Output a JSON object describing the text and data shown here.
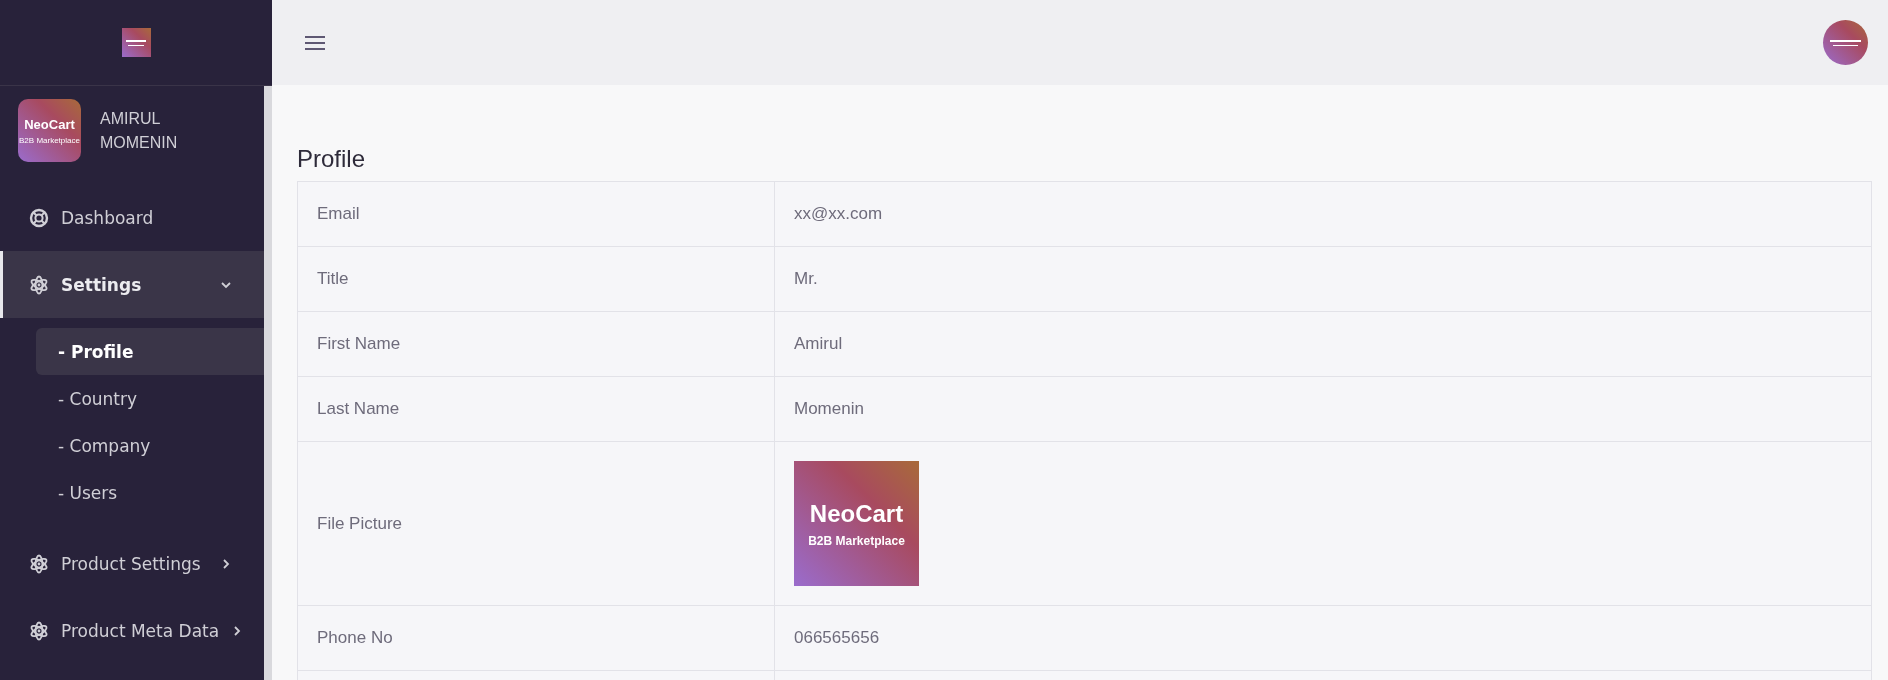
{
  "user": {
    "name": "AMIRUL MOMENIN",
    "avatar": {
      "brand": "NeoCart",
      "tagline": "B2B Marketplace"
    }
  },
  "menu": [
    {
      "label": "Dashboard",
      "kind": "link",
      "selected": false
    },
    {
      "label": "Settings",
      "kind": "group",
      "expanded": true,
      "selected": true,
      "children": [
        {
          "label": "- Profile",
          "selected": true
        },
        {
          "label": "- Country",
          "selected": false
        },
        {
          "label": "- Company",
          "selected": false
        },
        {
          "label": "- Users",
          "selected": false
        }
      ]
    },
    {
      "label": "Product Settings",
      "kind": "group",
      "expanded": false,
      "selected": false
    },
    {
      "label": "Product Meta Data",
      "kind": "group",
      "expanded": false,
      "selected": false
    }
  ],
  "page_title": "Profile",
  "profile": [
    {
      "label": "Email",
      "kind": "text",
      "value": "xx@xx.com"
    },
    {
      "label": "Title",
      "kind": "text",
      "value": "Mr."
    },
    {
      "label": "First Name",
      "kind": "text",
      "value": "Amirul"
    },
    {
      "label": "Last Name",
      "kind": "text",
      "value": "Momenin"
    },
    {
      "label": "File Picture",
      "brand": "NeoCart",
      "tagline": "B2B Marketplace"
    },
    {
      "label": "Phone No",
      "kind": "text",
      "value": "066565656"
    }
  ]
}
